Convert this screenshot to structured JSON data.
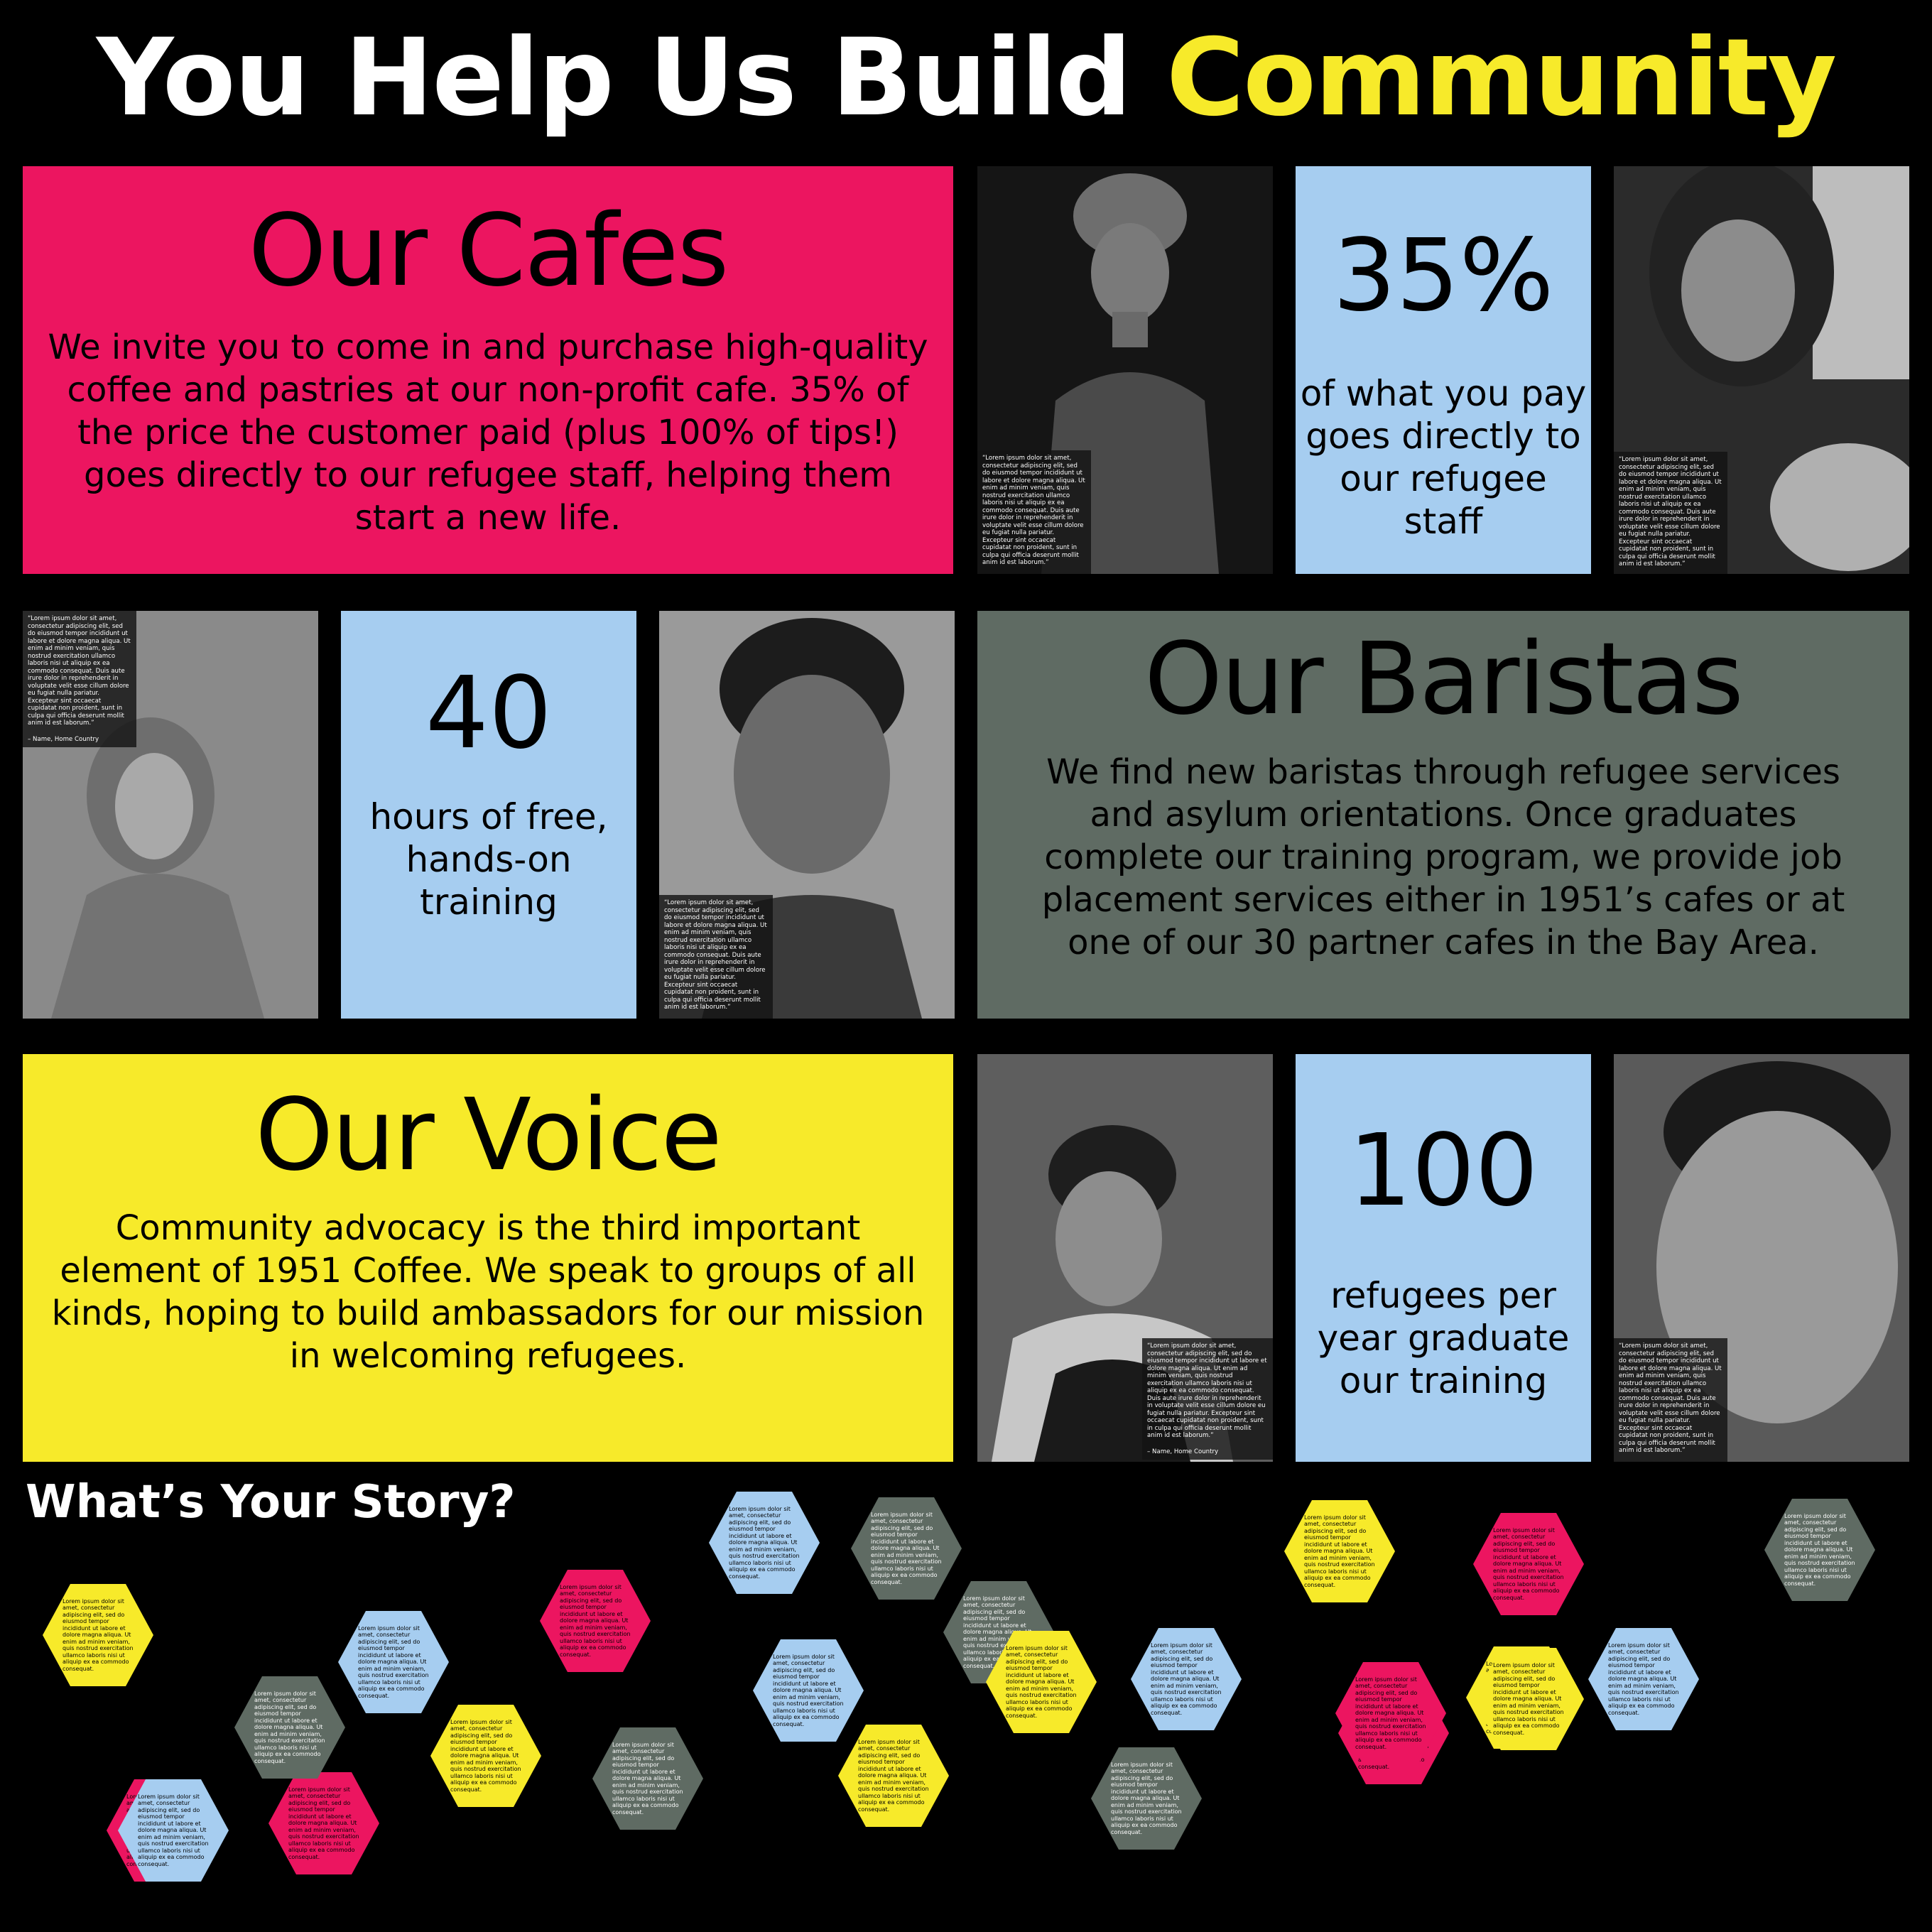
{
  "title": {
    "part1": "You Help Us Build",
    "part2": "Community"
  },
  "colors": {
    "pink": "#ec1560",
    "blue": "#a6cdf0",
    "gray": "#5f6b63",
    "yellow": "#f7ea2a",
    "bg": "#000000"
  },
  "cafes": {
    "heading": "Our Cafes",
    "body": "We invite you to come in and purchase high-quality coffee and pastries at our non-profit cafe. 35% of the price the customer paid (plus 100% of tips!) goes directly to our refugee staff, helping them start a new life."
  },
  "baristas": {
    "heading": "Our Baristas",
    "body": "We find new baristas through refugee services and asylum orientations. Once graduates complete our training program, we provide job placement services either in 1951’s cafes or at one of our 30 partner cafes in the Bay Area."
  },
  "voice": {
    "heading": "Our Voice",
    "body": "Community advocacy is the third important element of 1951 Coffee. We speak to groups of all kinds, hoping to build ambassadors for our mission in welcoming refugees."
  },
  "stats": [
    {
      "number": "35%",
      "text": "of what you pay goes directly to our refugee staff"
    },
    {
      "number": "40",
      "text": "hours of free, hands-on training"
    },
    {
      "number": "100",
      "text": "refugees per year graduate our training"
    }
  ],
  "quote": {
    "text": "“Lorem ipsum dolor sit amet, consectetur adipiscing elit, sed do eiusmod tempor incididunt ut labore et dolore magna aliqua. Ut enim ad minim veniam, quis nostrud exercitation ullamco laboris nisi ut aliquip ex ea commodo consequat. Duis aute irure dolor in reprehenderit in voluptate velit esse cillum dolore eu fugiat nulla pariatur. Excepteur sint occaecat cupidatat non proident, sunt in culpa qui officia deserunt mollit anim id est laborum.”",
    "author": "– Name, Home Country"
  },
  "story": {
    "heading": "What’s Your Story?",
    "hex_text": "Lorem ipsum dolor sit amet, consectetur adipiscing elit, sed do eiusmod tempor incididunt ut labore et dolore magna aliqua. Ut enim ad minim veniam, quis nostrud exercitation ullamco laboris nisi ut aliquip ex ea commodo consequat.",
    "hexagons": [
      {
        "color": "yellow"
      },
      {
        "color": "pink"
      },
      {
        "color": "blue"
      },
      {
        "color": "gray"
      },
      {
        "color": "yellow"
      },
      {
        "color": "gray"
      },
      {
        "color": "blue"
      },
      {
        "color": "pink"
      },
      {
        "color": "pink"
      },
      {
        "color": "yellow"
      },
      {
        "color": "blue"
      },
      {
        "color": "gray"
      },
      {
        "color": "yellow"
      },
      {
        "color": "pink"
      },
      {
        "color": "gray"
      },
      {
        "color": "blue"
      },
      {
        "color": "blue"
      },
      {
        "color": "pink"
      },
      {
        "color": "yellow"
      },
      {
        "color": "pink"
      },
      {
        "color": "yellow"
      },
      {
        "color": "blue"
      },
      {
        "color": "gray"
      },
      {
        "color": "gray"
      },
      {
        "color": "yellow"
      }
    ]
  }
}
